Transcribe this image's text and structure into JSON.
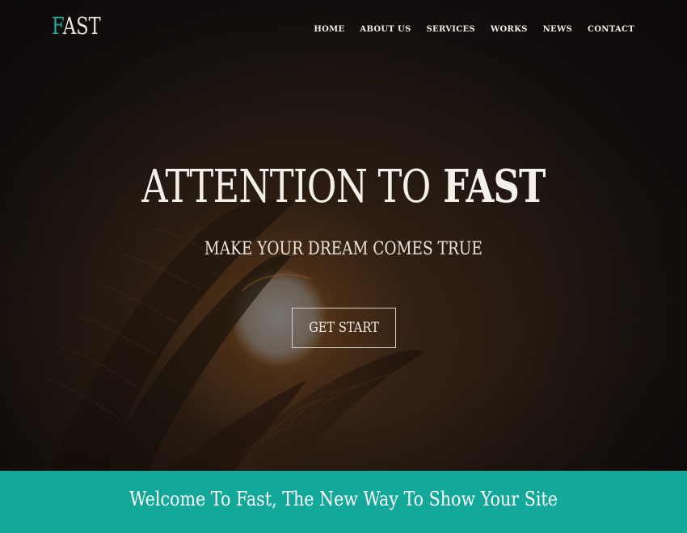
{
  "header": {
    "logo_first": "F",
    "logo_rest": "AST",
    "nav": [
      "HOME",
      "ABOUT US",
      "SERVICES",
      "WORKS",
      "NEWS",
      "CONTACT"
    ]
  },
  "hero": {
    "headline_light": "ATTENTION TO",
    "headline_bold": "FAST",
    "subheadline": "MAKE YOUR DREAM COMES TRUE",
    "cta_label": "GET START"
  },
  "banner": {
    "text": "Welcome To Fast, The New Way To Show Your Site"
  },
  "colors": {
    "accent": "#13a89a",
    "logo_accent": "#21a99a",
    "hero_dark": "#1d1510"
  }
}
